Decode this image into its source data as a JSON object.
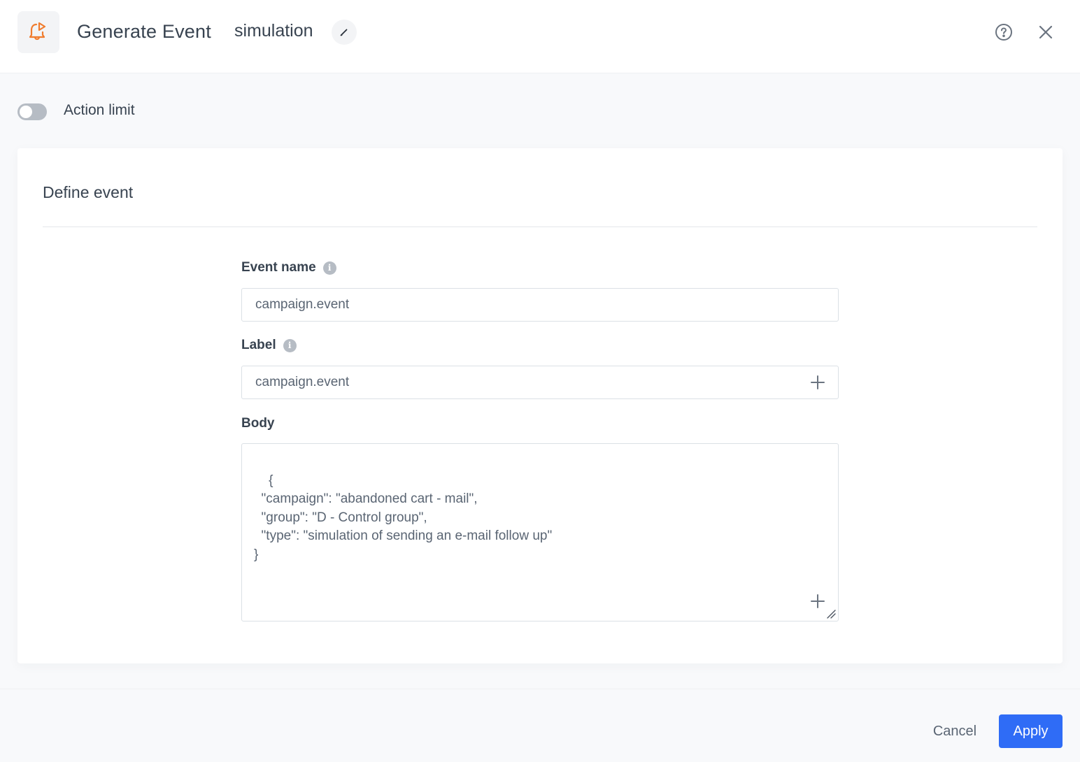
{
  "header": {
    "title": "Generate Event",
    "name": "simulation",
    "icons": {
      "app": "bell-play-icon",
      "edit": "pencil-icon",
      "help": "help-circle-icon",
      "close": "close-icon"
    }
  },
  "action_limit": {
    "label": "Action limit",
    "enabled": false
  },
  "card": {
    "title": "Define event",
    "fields": {
      "event_name": {
        "label": "Event name",
        "value": "campaign.event",
        "info_icon": "i"
      },
      "label": {
        "label": "Label",
        "value": "campaign.event",
        "info_icon": "i"
      },
      "body": {
        "label": "Body",
        "value": "{\n  \"campaign\": \"abandoned cart - mail\",\n  \"group\": \"D - Control group\",\n  \"type\": \"simulation of sending an e-mail follow up\"\n}"
      }
    }
  },
  "footer": {
    "cancel_label": "Cancel",
    "apply_label": "Apply"
  },
  "colors": {
    "accent": "#2f6cf6",
    "icon_orange": "#f07c2e",
    "text": "#384350",
    "toggle_off": "#b6bcc4"
  }
}
